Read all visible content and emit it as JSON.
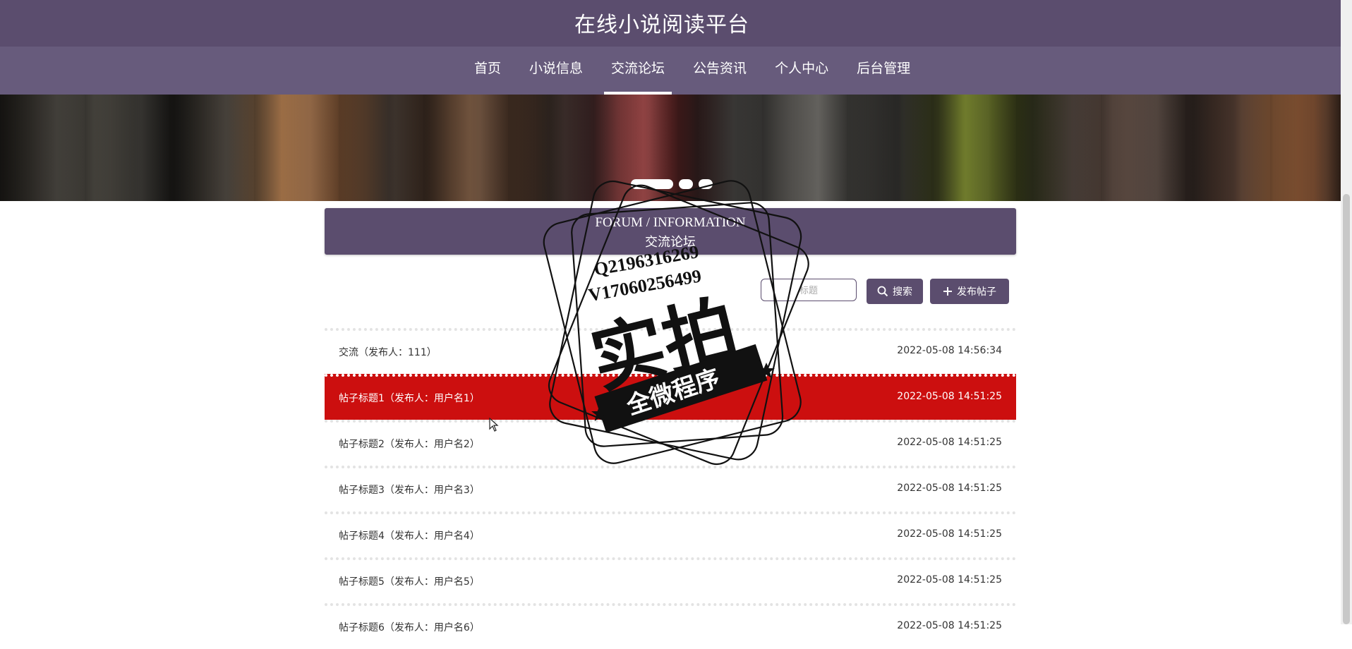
{
  "header": {
    "site_title": "在线小说阅读平台"
  },
  "nav": {
    "items": [
      {
        "label": "首页"
      },
      {
        "label": "小说信息"
      },
      {
        "label": "交流论坛",
        "active": true
      },
      {
        "label": "公告资讯"
      },
      {
        "label": "个人中心"
      },
      {
        "label": "后台管理"
      }
    ]
  },
  "banner": {
    "indicator_count": 3,
    "active_index": 0
  },
  "forum": {
    "title_en": "FORUM / INFORMATION",
    "title_cn": "交流论坛"
  },
  "toolbar": {
    "search_placeholder": "标题",
    "search_label": "搜索",
    "post_label": "发布帖子"
  },
  "posts": [
    {
      "title": "交流（发布人：111）",
      "time": "2022-05-08 14:56:34"
    },
    {
      "title": "帖子标题1（发布人：用户名1）",
      "time": "2022-05-08 14:51:25",
      "highlight": true
    },
    {
      "title": "帖子标题2（发布人：用户名2）",
      "time": "2022-05-08 14:51:25"
    },
    {
      "title": "帖子标题3（发布人：用户名3）",
      "time": "2022-05-08 14:51:25"
    },
    {
      "title": "帖子标题4（发布人：用户名4）",
      "time": "2022-05-08 14:51:25"
    },
    {
      "title": "帖子标题5（发布人：用户名5）",
      "time": "2022-05-08 14:51:25"
    },
    {
      "title": "帖子标题6（发布人：用户名6）",
      "time": "2022-05-08 14:51:25"
    }
  ],
  "watermark": {
    "line1": "Q2196316269",
    "line2": "V17060256499",
    "main": "实拍",
    "ribbon": "全微程序"
  },
  "colors": {
    "primary": "#5b4d6e",
    "nav": "#675b7c",
    "highlight_row": "#cc0f0f"
  }
}
